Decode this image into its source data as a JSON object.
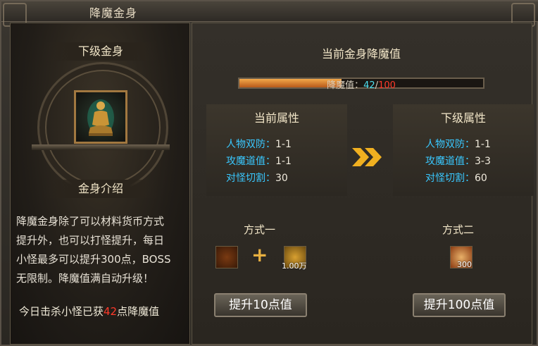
{
  "window": {
    "title": "降魔金身"
  },
  "left": {
    "next_label": "下级金身",
    "intro_label": "金身介绍",
    "description_lines": [
      "降魔金身除了可以材料货币方式",
      "提升外，也可以打怪提升，每日",
      "小怪最多可以提升300点，BOSS",
      "无限制。降魔值满自动升级！"
    ],
    "kill_prefix": "今日击杀小怪已获",
    "kill_value": "42",
    "kill_suffix": "点降魔值"
  },
  "progress": {
    "title": "当前金身降魔值",
    "label": "降魔值：",
    "current": "42",
    "separator": "/",
    "max": "100",
    "fraction": 0.42
  },
  "current_attrs": {
    "title": "当前属性",
    "rows": [
      {
        "name": "人物双防：",
        "value": "1-1"
      },
      {
        "name": "攻魔道值：",
        "value": "1-1"
      },
      {
        "name": "对怪切割：",
        "value": "30"
      }
    ]
  },
  "next_attrs": {
    "title": "下级属性",
    "rows": [
      {
        "name": "人物双防：",
        "value": "1-1"
      },
      {
        "name": "攻魔道值：",
        "value": "3-3"
      },
      {
        "name": "对怪切割：",
        "value": "60"
      }
    ]
  },
  "method1": {
    "title": "方式一",
    "currency_count": "1.00万",
    "button": "提升10点值"
  },
  "method2": {
    "title": "方式二",
    "item_count": "300",
    "button": "提升100点值"
  },
  "colors": {
    "accent": "#39c8ff",
    "highlight": "#ff3a2a",
    "bar": "#f3a84a"
  }
}
